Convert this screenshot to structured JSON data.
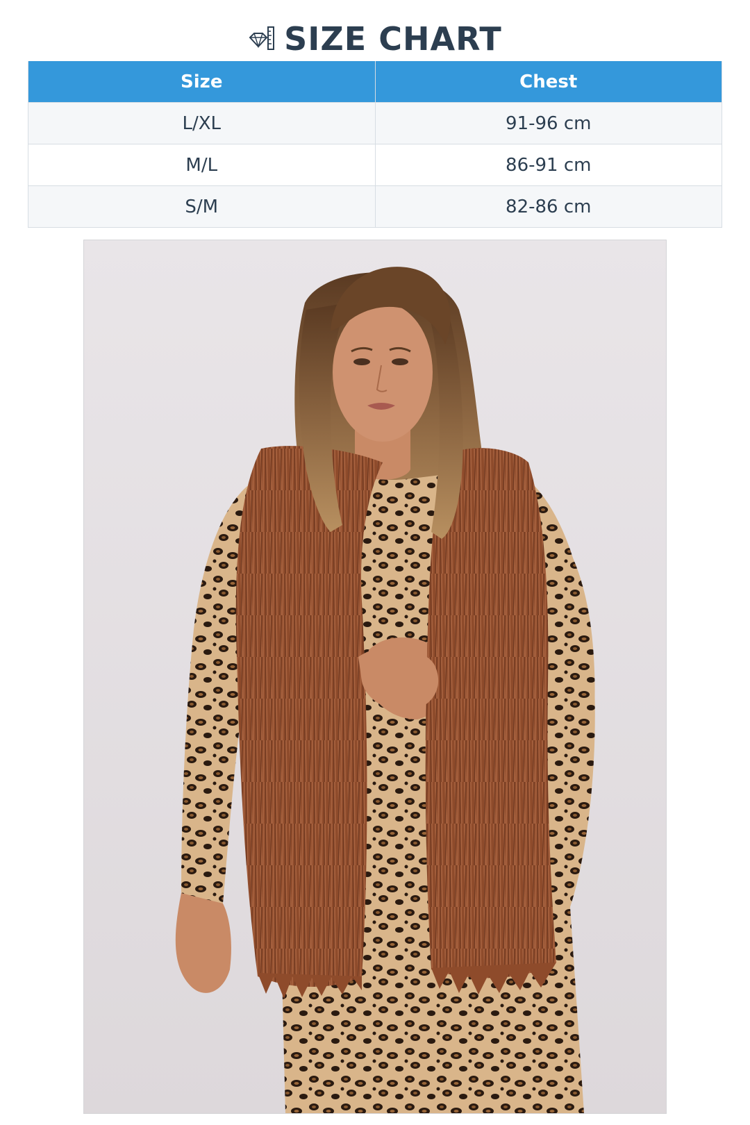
{
  "header": {
    "title": "SIZE CHART",
    "icon": "ruler-diamond-icon"
  },
  "table": {
    "columns": [
      "Size",
      "Chest"
    ],
    "rows": [
      {
        "size": "L/XL",
        "chest": "91-96 cm"
      },
      {
        "size": "M/L",
        "chest": "86-91 cm"
      },
      {
        "size": "S/M",
        "chest": "82-86 cm"
      }
    ]
  },
  "colors": {
    "header_bg": "#3498db",
    "header_text": "#ffffff",
    "title_text": "#2c3e50",
    "row_alt_bg": "#f5f7f9",
    "fur_brown": "#8a4a2a",
    "backdrop": "#e6e2e4"
  },
  "product_image": {
    "subject": "model-wearing-brown-faux-fur-vest"
  }
}
